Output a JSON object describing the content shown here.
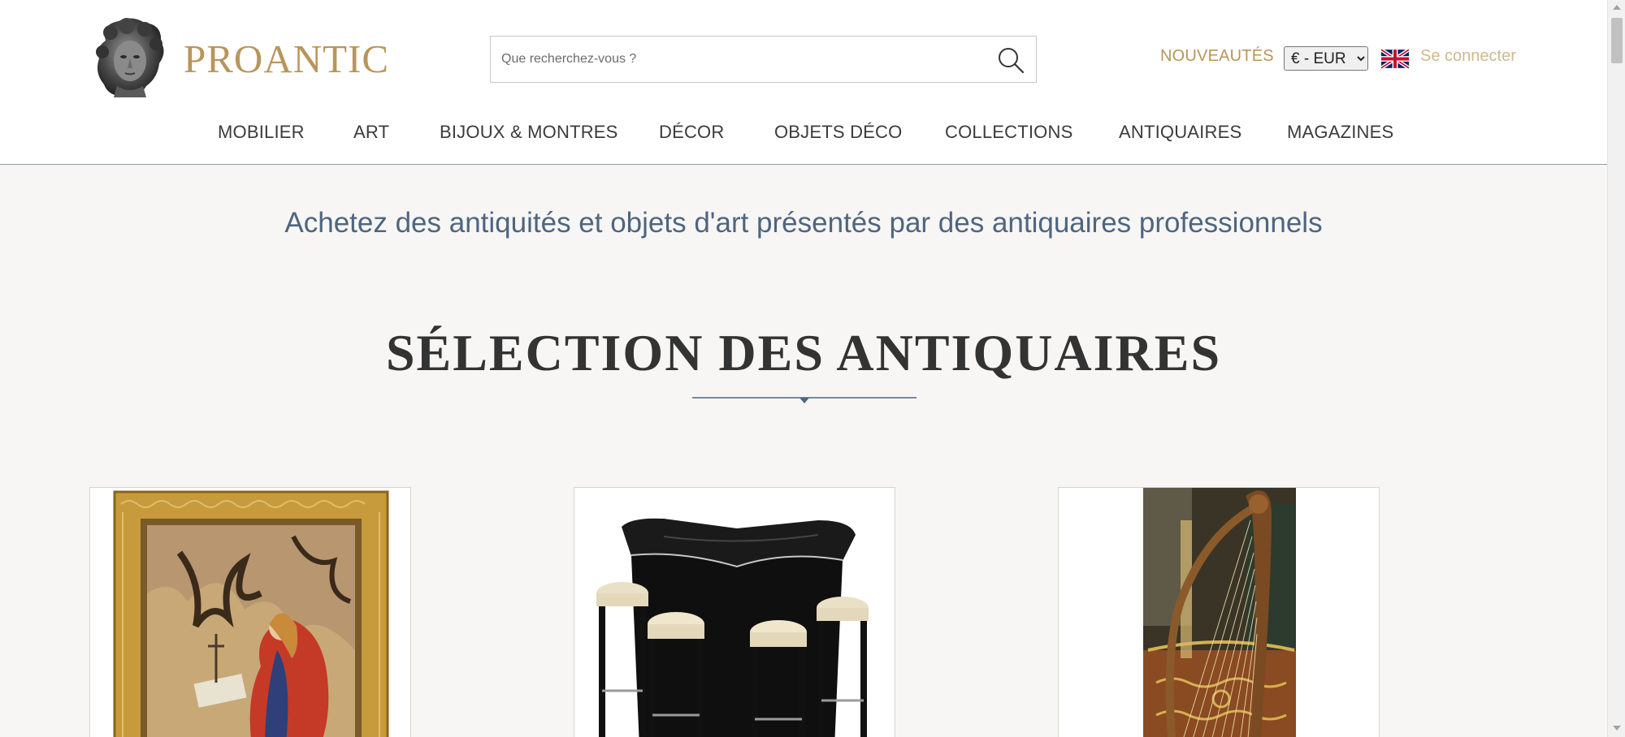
{
  "header": {
    "logo_text": "PROANTIC",
    "search": {
      "placeholder": "Que recherchez-vous ?",
      "value": ""
    },
    "nouveautes": "NOUVEAUTÉS",
    "currency": {
      "selected": "€ - EUR",
      "options": [
        "€ - EUR"
      ]
    },
    "language_icon": "uk-flag-icon",
    "login": "Se connecter"
  },
  "nav": {
    "items": [
      {
        "label": "MOBILIER"
      },
      {
        "label": "ART"
      },
      {
        "label": "BIJOUX & MONTRES"
      },
      {
        "label": "DÉCOR"
      },
      {
        "label": "OBJETS DÉCO"
      },
      {
        "label": "COLLECTIONS"
      },
      {
        "label": "ANTIQUAIRES"
      },
      {
        "label": "MAGAZINES"
      }
    ]
  },
  "main": {
    "tagline": "Achetez des antiquités et objets d'art présentés par des antiquaires professionnels",
    "section_title": "SÉLECTION DES ANTIQUAIRES",
    "cards": [
      {
        "image": "gilded-framed-religious-painting"
      },
      {
        "image": "black-art-deco-bar-with-stools"
      },
      {
        "image": "carved-harp-and-commode"
      }
    ]
  },
  "colors": {
    "brand_gold": "#b8955a",
    "nav_text": "#3b3b3b",
    "tagline_blue": "#4e6580",
    "page_bg": "#f7f6f4"
  }
}
